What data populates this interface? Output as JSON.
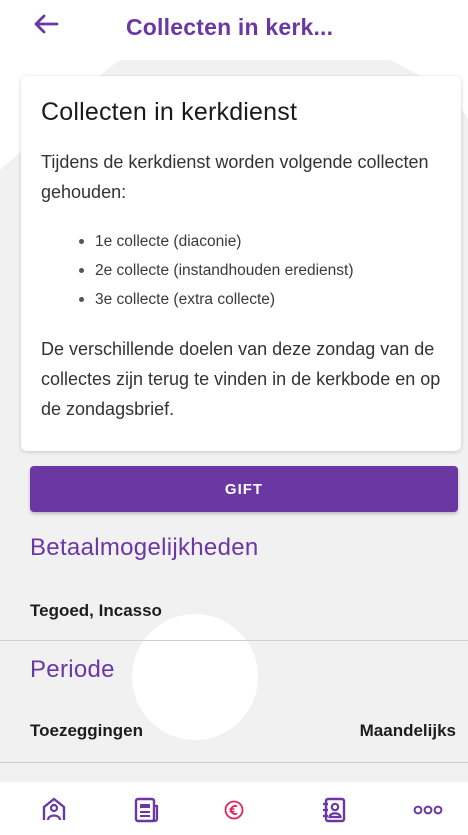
{
  "header": {
    "title": "Collecten in kerk..."
  },
  "card": {
    "title": "Collecten in kerkdienst",
    "intro": "Tijdens de kerkdienst worden volgende collecten gehouden:",
    "items": [
      "1e collecte (diaconie)",
      "2e collecte (instandhouden eredienst)",
      "3e collecte (extra collecte)"
    ],
    "outro": "De verschillende doelen van deze zondag van de collectes zijn terug te vinden in de kerkbode en op de zondagsbrief."
  },
  "gift_button": {
    "label": "GIFT"
  },
  "payment": {
    "heading": "Betaalmogelijkheden",
    "value": "Tegoed, Incasso"
  },
  "period": {
    "heading": "Periode",
    "label": "Toezeggingen",
    "value": "Maandelijks"
  },
  "bottom_nav": {
    "items": [
      "home-icon",
      "news-icon",
      "euro-icon",
      "contacts-icon",
      "more-icon"
    ]
  },
  "colors": {
    "accent": "#6b37a3",
    "nav_icon": "#6b37a3",
    "euro_icon": "#e0245e"
  }
}
